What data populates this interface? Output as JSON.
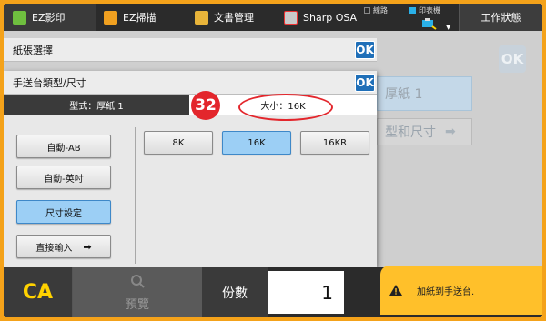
{
  "topbar": {
    "tabs": [
      {
        "label": "EZ影印",
        "icon": "copy-icon"
      },
      {
        "label": "EZ掃描",
        "icon": "scan-icon"
      },
      {
        "label": "文書管理",
        "icon": "folder-icon"
      },
      {
        "label": "Sharp OSA",
        "icon": "osa-icon"
      }
    ],
    "status_line": "線路",
    "status_printer": "印表機",
    "job_status": "工作狀態"
  },
  "background": {
    "ok_label": "OK",
    "ghost_item1": "厚紙 1",
    "ghost_item2": "型和尺寸"
  },
  "dialog1": {
    "title": "紙張選擇",
    "ok_label": "OK"
  },
  "dialog2": {
    "title": "手送台類型/尺寸",
    "ok_label": "OK",
    "type_tab": "型式：厚紙 1",
    "size_tab": "大小：16K",
    "left_buttons": [
      "自動-AB",
      "自動-英吋",
      "尺寸設定",
      "直接輸入"
    ],
    "size_buttons": [
      "8K",
      "16K",
      "16KR"
    ]
  },
  "annotation": {
    "number": "32"
  },
  "bottom": {
    "ca_label": "CA",
    "preview_label": "預覽",
    "copies_label": "份數",
    "copies_value": "1",
    "message": "加紙到手送台."
  },
  "colors": {
    "accent": "#1f6fb8",
    "selected": "#9ccff5",
    "annotation": "#e3262c",
    "warning": "#ffc02a"
  }
}
